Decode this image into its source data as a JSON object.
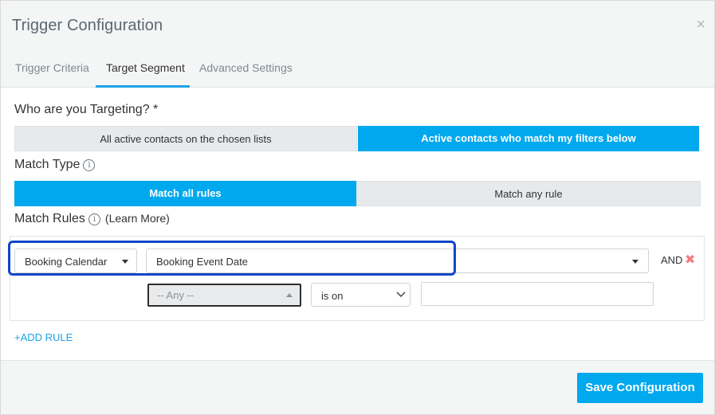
{
  "modal": {
    "title": "Trigger Configuration",
    "close_label": "×"
  },
  "tabs": [
    {
      "label": "Trigger Criteria",
      "active": false
    },
    {
      "label": "Target Segment",
      "active": true
    },
    {
      "label": "Advanced Settings",
      "active": false
    }
  ],
  "targeting": {
    "heading": "Who are you Targeting? *",
    "options": [
      {
        "label": "All active contacts on the chosen lists",
        "selected": false
      },
      {
        "label": "Active contacts who match my filters below",
        "selected": true
      }
    ]
  },
  "match_type": {
    "heading": "Match Type",
    "info_icon": "i",
    "options": [
      {
        "label": "Match all rules",
        "selected": true
      },
      {
        "label": "Match any rule",
        "selected": false
      }
    ]
  },
  "match_rules": {
    "heading": "Match Rules",
    "info_icon": "i",
    "learn_more": "(Learn More)",
    "rule": {
      "source_value": "Booking Calendar",
      "field_value": "Booking Event Date",
      "conjunction": "AND",
      "remove_label": "✖",
      "sub_select_value": "-- Any --",
      "operator_value": "is on",
      "value_input": ""
    },
    "add_rule_label": "+ADD RULE"
  },
  "footer": {
    "save_label": "Save Configuration"
  },
  "colors": {
    "accent": "#00a8ee",
    "highlight": "#1245c7",
    "remove": "#f08080"
  }
}
